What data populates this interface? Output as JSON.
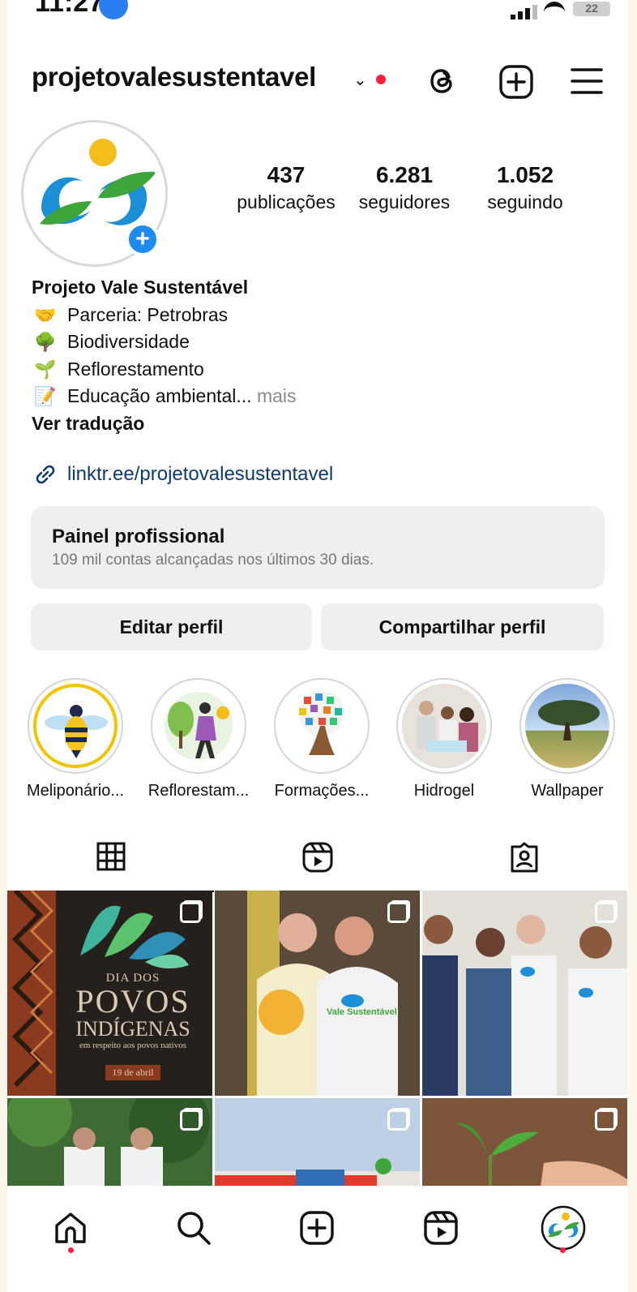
{
  "status_bar": {
    "time": "11:27",
    "battery": "22"
  },
  "header": {
    "username": "projetovalesustentavel"
  },
  "stats": [
    {
      "value": "437",
      "label": "publicações"
    },
    {
      "value": "6.281",
      "label": "seguidores"
    },
    {
      "value": "1.052",
      "label": "seguindo"
    }
  ],
  "bio": {
    "name": "Projeto Vale Sustentável",
    "lines": [
      {
        "emoji": "🤝",
        "text": "Parceria: Petrobras"
      },
      {
        "emoji": "🌳",
        "text": "Biodiversidade"
      },
      {
        "emoji": "🌱",
        "text": "Reflorestamento"
      },
      {
        "emoji": "📝",
        "text": "Educação ambiental..."
      }
    ],
    "more": "mais",
    "translate": "Ver tradução"
  },
  "link": "linktr.ee/projetovalesustentavel",
  "panel": {
    "title": "Painel profissional",
    "subtitle": "109 mil contas alcançadas nos últimos 30 dias."
  },
  "buttons": {
    "edit": "Editar perfil",
    "share": "Compartilhar perfil"
  },
  "highlights": [
    {
      "label": "Meliponário..."
    },
    {
      "label": "Reflorestam..."
    },
    {
      "label": "Formações..."
    },
    {
      "label": "Hidrogel"
    },
    {
      "label": "Wallpaper"
    }
  ],
  "posts": {
    "first": {
      "line1": "DIA DOS",
      "line2": "POVOS",
      "line3": "INDÍGENAS",
      "line4": "em respeito aos povos nativos",
      "date": "19 de abril"
    },
    "shirt_text": "Vale Sustentável"
  },
  "icons": {
    "threads": "threads-icon",
    "new_post": "new-post-icon",
    "menu": "menu-icon",
    "grid": "grid-icon",
    "reels": "reels-icon",
    "tagged": "tagged-icon",
    "home": "home-icon",
    "search": "search-icon",
    "create": "create-icon",
    "reels_nav": "reels-nav-icon",
    "profile": "profile-avatar-icon"
  },
  "colors": {
    "accent_link": "#0c3a75",
    "badge_blue": "#1d8bf1",
    "notification_red": "#ff1f3d",
    "brand_green": "#3ea53a",
    "brand_blue": "#1c8fd6",
    "brand_yellow": "#f4bd1b"
  }
}
